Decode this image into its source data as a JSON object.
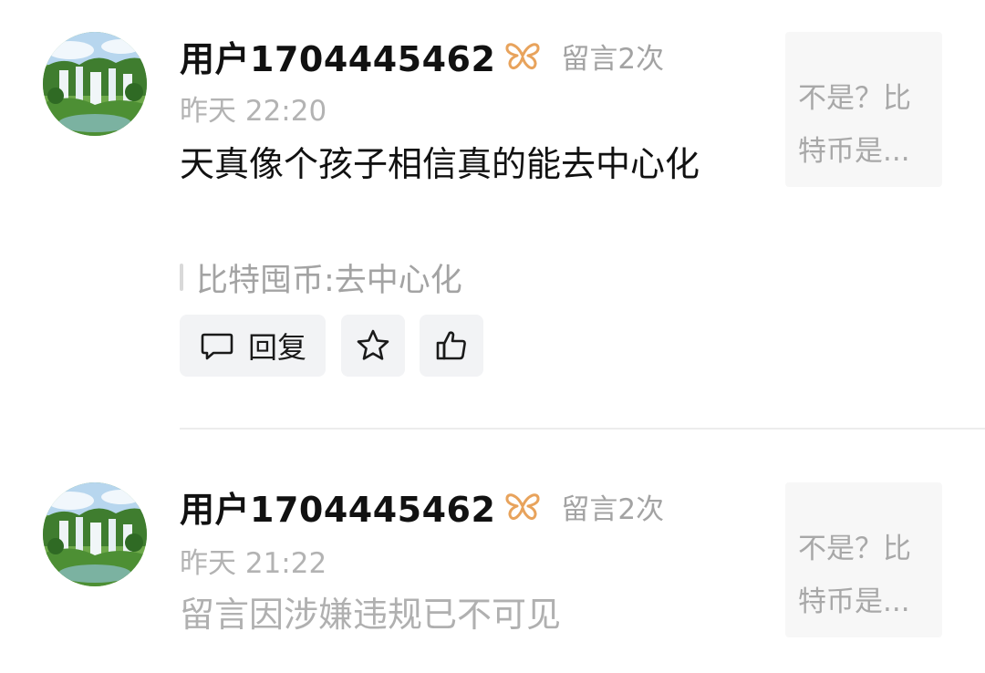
{
  "comments": [
    {
      "username": "用户1704445462",
      "badge_icon": "butterfly-badge-icon",
      "message_count": "留言2次",
      "time": "昨天 22:20",
      "content": "天真像个孩子相信真的能去中心化",
      "quote": "比特囤币:去中心化",
      "actions": {
        "reply_label": "回复",
        "star_icon": "star-icon",
        "like_icon": "thumbs-up-icon",
        "reply_icon": "comment-bubble-icon"
      },
      "ref_card": {
        "line1": "不是？比",
        "line2": "特币是..."
      }
    },
    {
      "username": "用户1704445462",
      "badge_icon": "butterfly-badge-icon",
      "message_count": "留言2次",
      "time": "昨天 21:22",
      "content": "留言因涉嫌违规已不可见",
      "ref_card": {
        "line1": "不是？比",
        "line2": "特币是..."
      }
    }
  ],
  "colors": {
    "badge": "#e8a35c",
    "muted_text": "#a3a3a3",
    "button_bg": "#f2f3f5",
    "divider": "#ececec"
  }
}
